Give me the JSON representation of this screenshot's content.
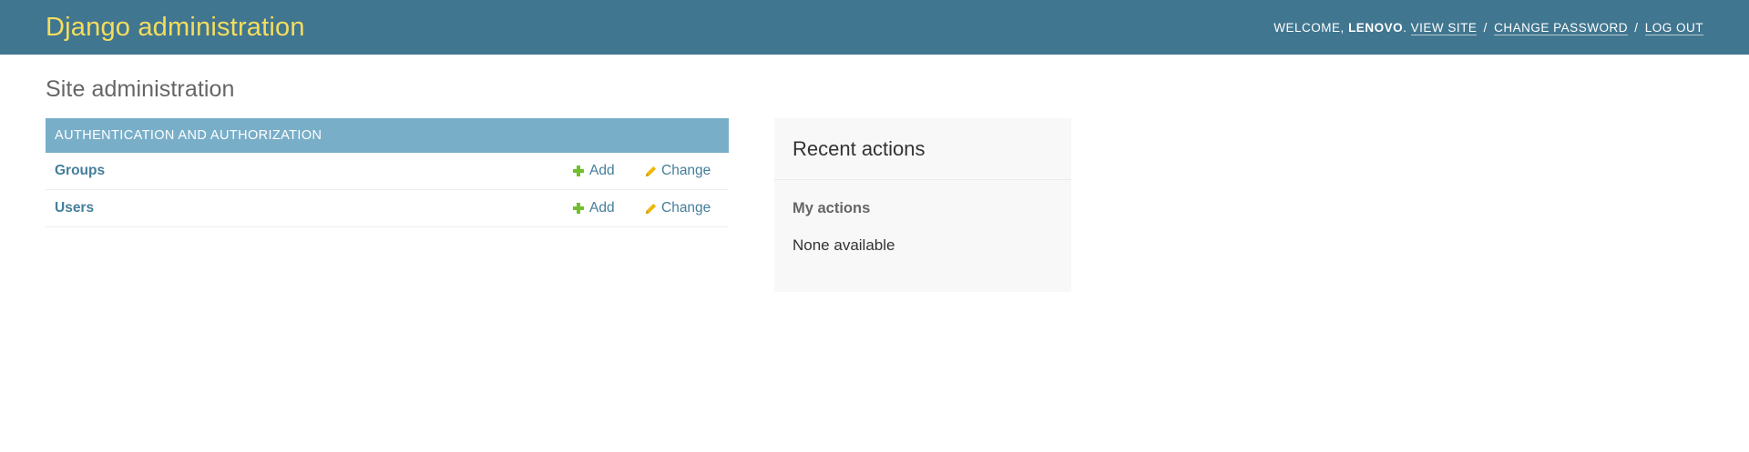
{
  "header": {
    "branding": "Django administration",
    "welcome": "Welcome,",
    "username": "Lenovo",
    "username_suffix": ".",
    "view_site": "View site",
    "separator": "/",
    "change_password": "Change password",
    "log_out": "Log out"
  },
  "page": {
    "title": "Site administration"
  },
  "app_module": {
    "caption": "Authentication and Authorization",
    "models": [
      {
        "name": "Groups",
        "add_label": "Add",
        "change_label": "Change"
      },
      {
        "name": "Users",
        "add_label": "Add",
        "change_label": "Change"
      }
    ]
  },
  "recent_actions": {
    "title": "Recent actions",
    "subtitle": "My actions",
    "empty_text": "None available"
  },
  "colors": {
    "header_bg": "#417690",
    "branding": "#f5dd5d",
    "caption_bg": "#79aec8",
    "link": "#447e9b",
    "add_icon": "#70bf2b",
    "change_icon": "#efb80b"
  },
  "icons": {
    "add": "plus-icon",
    "change": "pencil-icon"
  }
}
